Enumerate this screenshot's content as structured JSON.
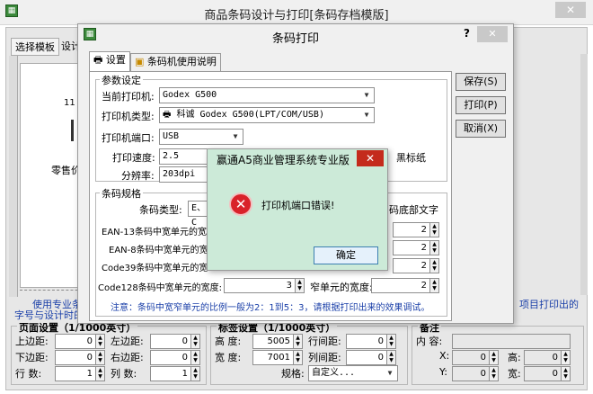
{
  "outer": {
    "title": "商品条码设计与打印[条码存档模版]",
    "close_glyph": "✕",
    "toolbar": {
      "select_template": "选择模板",
      "design": "设计"
    },
    "canvas": {
      "number": "11",
      "text": "零售价"
    },
    "hint_top": "使用专业条",
    "hint_bottom": "字号与设计时的",
    "right_hint": "项目打印出的",
    "page_settings": {
      "title": "页面设置（1/1000英寸）",
      "rows": [
        {
          "l1": "上边距:",
          "v1": "0",
          "l2": "左边距:",
          "v2": "0"
        },
        {
          "l1": "下边距:",
          "v1": "0",
          "l2": "右边距:",
          "v2": "0"
        },
        {
          "l1": "行    数:",
          "v1": "1",
          "l2": "列    数:",
          "v2": "1"
        }
      ]
    },
    "paper_settings": {
      "title": "标签设置（1/1000英寸）",
      "height_label": "高    度:",
      "height_value": "5005",
      "width_label": "宽    度:",
      "width_value": "7001",
      "row_gap_label": "行间距:",
      "row_gap_value": "0",
      "col_gap_label": "列间距:",
      "col_gap_value": "0",
      "spec_label": "规格:",
      "spec_value": "自定义..."
    },
    "other": {
      "title": "备注",
      "content_label": "内    容:",
      "x_label": "X:",
      "x_value": "0",
      "y_label": "Y:",
      "y_value": "0",
      "h_label": "高:",
      "h_value": "0",
      "w_label": "宽:",
      "w_value": "0"
    }
  },
  "dialog": {
    "title": "条码打印",
    "help": "?",
    "close_glyph": "✕",
    "tabs": [
      {
        "label": "设置"
      },
      {
        "label": "条码机使用说明"
      }
    ],
    "params": {
      "title": "参数设定",
      "printer_label": "当前打印机:",
      "printer_value": "Godex G500",
      "type_label": "打印机类型:",
      "type_value": "科诚 Godex G500(LPT/COM/USB)",
      "port_label": "打印机端口:",
      "port_value": "USB",
      "speed_label": "打印速度:",
      "speed_value": "2.5 inch/s",
      "dpi_label": "分辨率:",
      "dpi_value": "203dpi",
      "side_text": "黑标纸"
    },
    "barcode": {
      "title": "条码规格",
      "type_label": "条码类型:",
      "type_value": "E、C",
      "bottom_text": "码底部文字",
      "ean13": "EAN-13条码中宽单元的宽",
      "ean8": "EAN-8条码中宽单元的宽",
      "code39": "Code39条码中宽单元的宽",
      "code128": "Code128条码中宽单元的宽度:",
      "code128_wide": "3",
      "narrow_label": "窄单元的宽度:",
      "narrow_value": "2",
      "right_vals": [
        "2",
        "2",
        "2"
      ],
      "note": "注意：条码中宽窄单元的比例一般为2：1到5：3，请根据打印出来的效果调试。"
    },
    "buttons": {
      "save": "保存(S)",
      "print": "打印(P)",
      "cancel": "取消(X)"
    }
  },
  "popup": {
    "title": "赢通A5商业管理系统专业版",
    "close_glyph": "✕",
    "message": "打印机端口错误!",
    "ok": "确定"
  }
}
